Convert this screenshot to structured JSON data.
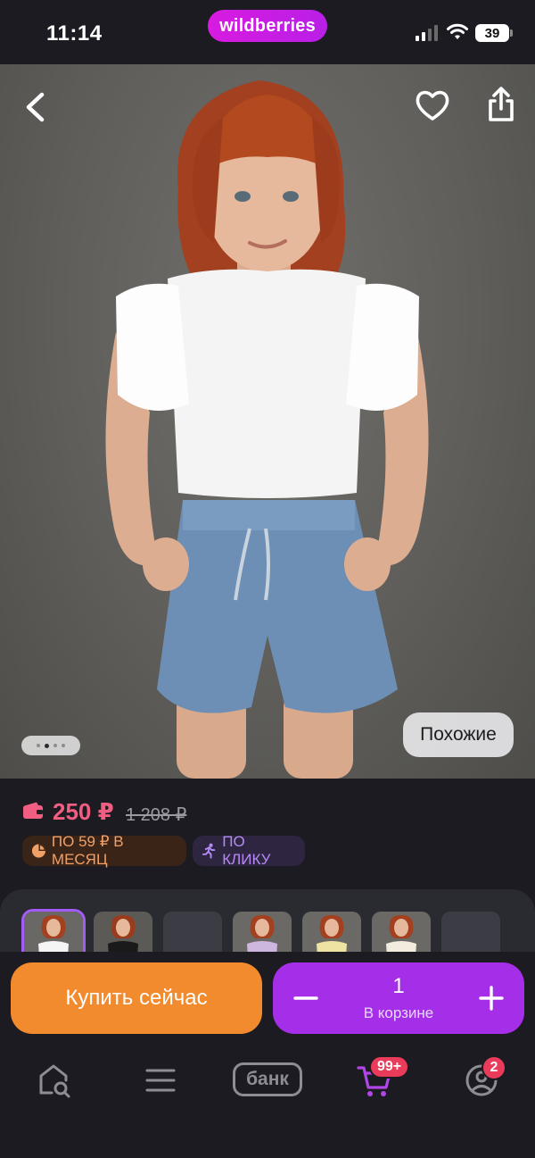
{
  "status_bar": {
    "time": "11:14",
    "brand": "wildberries",
    "battery": "39"
  },
  "hero": {
    "similar_label": "Похожие",
    "image_count_dots": 4,
    "active_dot": 2
  },
  "price": {
    "current": "250 ₽",
    "old": "1 208 ₽",
    "installment_badge": "ПО 59 ₽ В МЕСЯЦ",
    "click_badge": "ПО КЛИКУ"
  },
  "gallery": {
    "thumbs": [
      {
        "name": "thumb-white-top",
        "selected": true
      },
      {
        "name": "thumb-black-top",
        "selected": false
      },
      {
        "name": "thumb-empty",
        "selected": false
      },
      {
        "name": "thumb-lilac-top",
        "selected": false
      },
      {
        "name": "thumb-yellow-top",
        "selected": false
      },
      {
        "name": "thumb-cream-top",
        "selected": false
      },
      {
        "name": "thumb-empty-2",
        "selected": false
      }
    ]
  },
  "actions": {
    "buy_now": "Купить сейчас",
    "quantity": "1",
    "in_cart": "В корзине"
  },
  "bottom_nav": {
    "bank_label": "банк",
    "cart_badge": "99+",
    "profile_badge": "2"
  },
  "colors": {
    "background": "#1c1b21",
    "brand": "#cb1de3",
    "price": "#f25d82",
    "buy_button": "#f28a2e",
    "cart_button": "#a52fe8",
    "badge": "#ea3b5a"
  },
  "icons": [
    "back-icon",
    "heart-icon",
    "share-icon",
    "wallet-icon",
    "pie-icon",
    "runner-icon",
    "minus-icon",
    "plus-icon",
    "home-search-icon",
    "menu-icon",
    "cart-icon",
    "profile-icon"
  ]
}
